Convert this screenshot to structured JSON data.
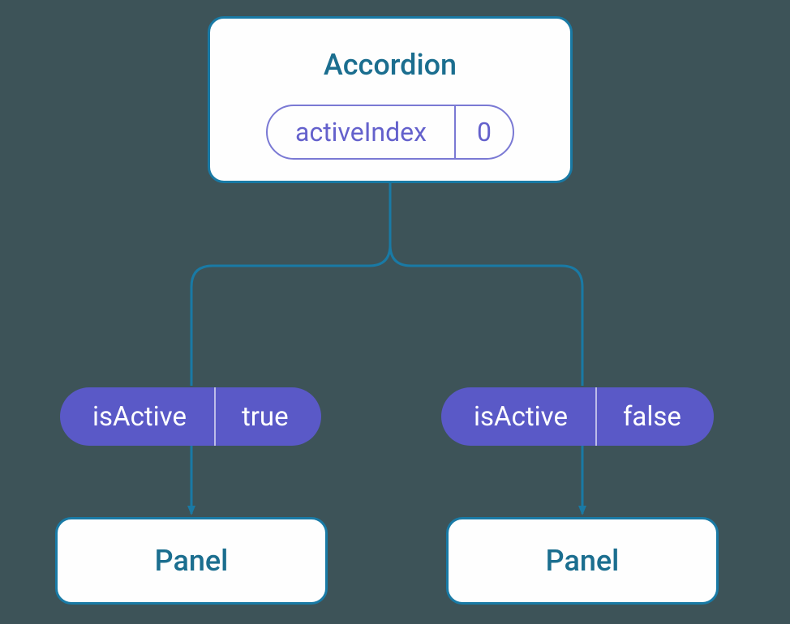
{
  "accordion": {
    "title": "Accordion",
    "state": {
      "label": "activeIndex",
      "value": "0"
    }
  },
  "props": {
    "left": {
      "label": "isActive",
      "value": "true"
    },
    "right": {
      "label": "isActive",
      "value": "false"
    }
  },
  "panels": {
    "left": "Panel",
    "right": "Panel"
  },
  "colors": {
    "background": "#3d5358",
    "boxBorder": "#197aa5",
    "boxBg": "#fefefe",
    "titleText": "#1b6e8f",
    "stateBorder": "#7a79d4",
    "stateText": "#6461cc",
    "propBg": "#5a59c7",
    "propText": "#ffffff"
  }
}
